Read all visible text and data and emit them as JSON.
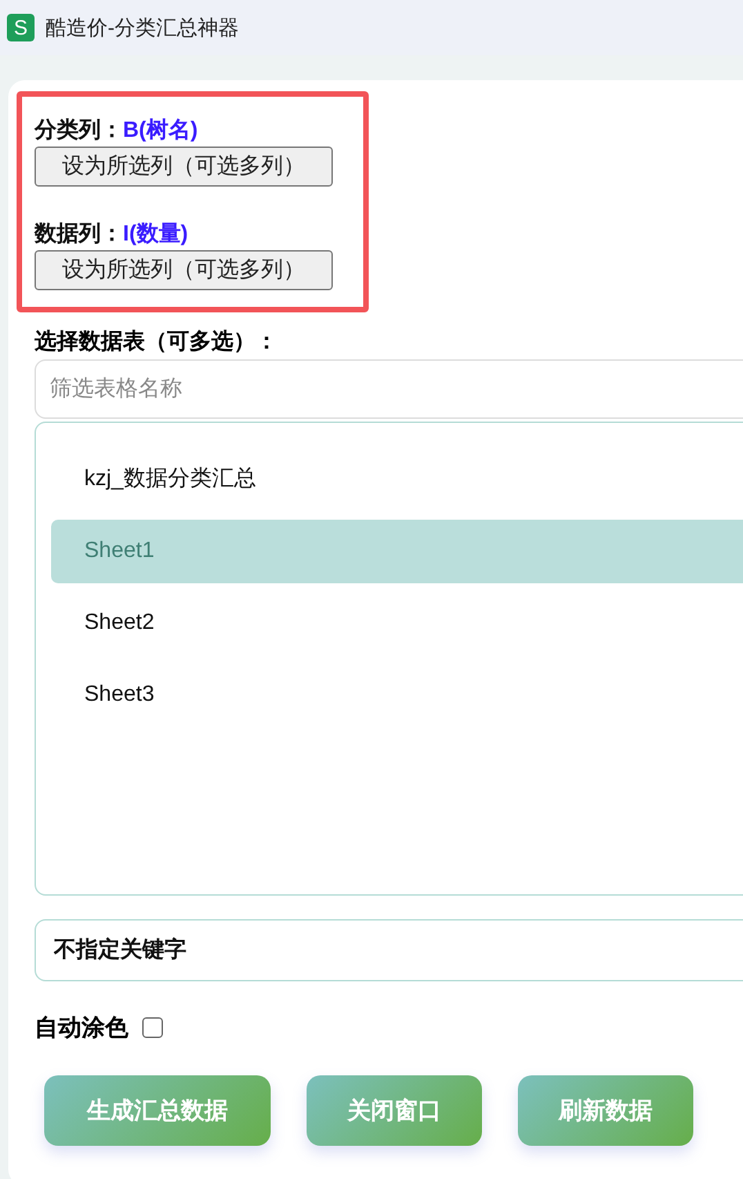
{
  "window": {
    "title": "酷造价-分类汇总神器",
    "icon": "S"
  },
  "column_settings": [
    {
      "label": "分类列：",
      "value": "B(树名)",
      "button": "设为所选列（可选多列）"
    },
    {
      "label": "数据列：",
      "value": "I(数量)",
      "button": "设为所选列（可选多列）"
    }
  ],
  "sheet_picker": {
    "label": "选择数据表（可多选）：",
    "search": {
      "placeholder": "筛选表格名称"
    },
    "sheets": [
      {
        "name": "kzj_数据分类汇总",
        "selected": false
      },
      {
        "name": "Sheet1",
        "selected": true
      },
      {
        "name": "Sheet2",
        "selected": false
      },
      {
        "name": "Sheet3",
        "selected": false
      }
    ]
  },
  "keyword": {
    "value": "不指定关键字"
  },
  "auto_color": {
    "label": "自动涂色",
    "checked": false
  },
  "buttons": [
    "生成汇总数据",
    "关闭窗口",
    "刷新数据"
  ]
}
